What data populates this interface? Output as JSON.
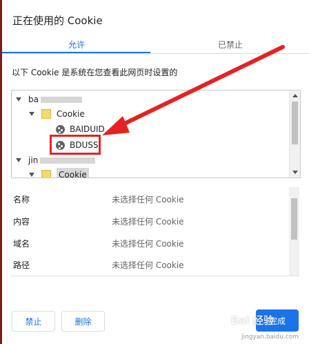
{
  "dialog": {
    "title": "正在使用的 Cookie",
    "tabs": {
      "allow": "允许",
      "blocked": "已禁止"
    },
    "description": "以下 Cookie 是系统在您查看此网页时设置的"
  },
  "tree": {
    "site1": "ba",
    "folder1": "Cookie",
    "cookie1": "BAIDUID",
    "cookie2": "BDUSS",
    "site2": "jin",
    "folder2": "Cookie"
  },
  "details": [
    {
      "label": "名称",
      "value": "未选择任何 Cookie"
    },
    {
      "label": "内容",
      "value": "未选择任何 Cookie"
    },
    {
      "label": "域名",
      "value": "未选择任何 Cookie"
    },
    {
      "label": "路径",
      "value": "未选择任何 Cookie"
    }
  ],
  "buttons": {
    "block": "禁止",
    "delete": "删除",
    "done": "完成"
  },
  "watermark": {
    "text": "Bai 经验",
    "url": "jingyan.baidu.com"
  },
  "colors": {
    "accent": "#1a73e8",
    "annotation": "#e52222"
  }
}
